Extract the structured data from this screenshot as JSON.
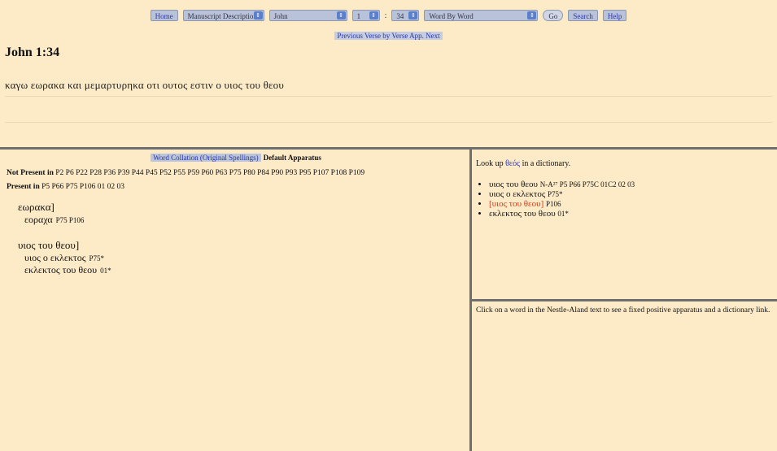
{
  "toolbar": {
    "home_label": "Home",
    "view_select": "Manuscript Descriptions",
    "book_select": "John",
    "chapter_select": "1",
    "colon": ":",
    "verse_select": "34",
    "mode_select": "Word By Word",
    "go_label": "Go",
    "search_label": "Search",
    "help_label": "Help"
  },
  "nav": {
    "prev_next": "Previous Verse by Verse App. Next"
  },
  "page_title": "John 1:34",
  "verse_text": "καγω εωρακα και μεμαρτυρηκα οτι ουτος εστιν ο υιος του θεου",
  "apparatus": {
    "tab_active": "Word Collation (Original Spellings)",
    "tab_default": "Default Apparatus",
    "not_present_label": "Not Present in",
    "not_present_list": "P2 P6 P22 P28 P36 P39 P44 P45 P52 P55 P59 P60 P63 P75 P80 P84 P90 P93 P95 P107 P108 P109",
    "present_label": "Present in",
    "present_list": "P5 P66 P75 P106 01 02 03",
    "entries": [
      {
        "lemma": "εωρακα]",
        "variants": [
          {
            "text": "εοραχα",
            "wits": "P75 P106"
          }
        ]
      },
      {
        "lemma": "υιος του θεου]",
        "variants": [
          {
            "text": "υιος ο εκλεκτος",
            "wits": "P75*"
          },
          {
            "text": "εκλεκτος του θεου",
            "wits": "01*"
          }
        ]
      }
    ]
  },
  "lookup": {
    "prefix": "Look up",
    "word": "θεός",
    "suffix": "in a dictionary.",
    "readings": [
      {
        "text": "υιος του θεου",
        "wits": "N-A²⁷ P5 P66 P75C 01C2 02 03"
      },
      {
        "text": "υιος ο εκλεκτος",
        "wits": "P75*"
      },
      {
        "text": "[υιος του θεου]",
        "wits": "P106"
      },
      {
        "text": "εκλεκτος του θεου",
        "wits": "01*"
      }
    ]
  },
  "help_text": "Click on a word in the Nestle-Aland text to see a fixed positive apparatus and a dictionary link.",
  "colors": {
    "background": "#fdebc8",
    "toolbar": "#b8c2d8",
    "link": "#2a35a8",
    "highlight": "#d23b1e"
  }
}
